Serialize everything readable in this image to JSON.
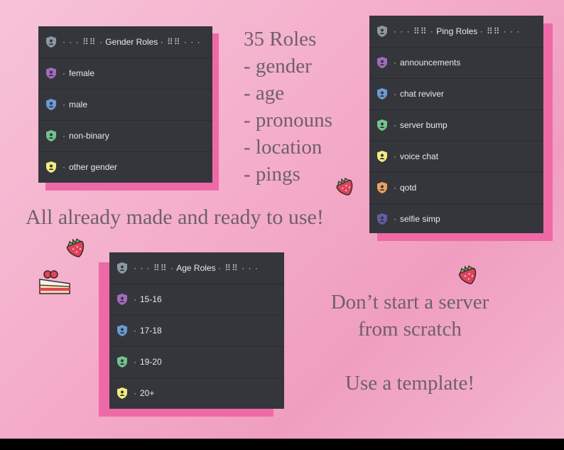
{
  "colors": {
    "panel": "#35363b",
    "accent_shadow": "#ee6aa7",
    "text": "#6f6068",
    "role_colors": {
      "grey": "#8a9aa3",
      "purple": "#a26bbd",
      "blue": "#6a9bd6",
      "green": "#72c48c",
      "yellow": "#f1ec7e",
      "orange": "#eda160",
      "indigo": "#5e5fa6"
    }
  },
  "gender_panel": {
    "title": "Gender Roles",
    "roles": [
      {
        "label": "female",
        "icon": "purple-shield-icon"
      },
      {
        "label": "male",
        "icon": "blue-shield-icon"
      },
      {
        "label": "non-binary",
        "icon": "green-shield-icon"
      },
      {
        "label": "other gender",
        "icon": "yellow-shield-icon"
      }
    ]
  },
  "ping_panel": {
    "title": "Ping Roles",
    "roles": [
      {
        "label": "announcements",
        "icon": "purple-shield-icon"
      },
      {
        "label": "chat reviver",
        "icon": "blue-shield-icon"
      },
      {
        "label": "server bump",
        "icon": "green-shield-icon"
      },
      {
        "label": "voice chat",
        "icon": "yellow-shield-icon"
      },
      {
        "label": "qotd",
        "icon": "orange-shield-icon"
      },
      {
        "label": "selfie simp",
        "icon": "indigo-shield-icon"
      }
    ]
  },
  "age_panel": {
    "title": "Age Roles",
    "roles": [
      {
        "label": "15-16",
        "icon": "purple-shield-icon"
      },
      {
        "label": "17-18",
        "icon": "blue-shield-icon"
      },
      {
        "label": "19-20",
        "icon": "green-shield-icon"
      },
      {
        "label": "20+",
        "icon": "yellow-shield-icon"
      }
    ]
  },
  "summary": {
    "count": "35 Roles",
    "items": [
      "- gender",
      "- age",
      "- pronouns",
      "- location",
      "- pings"
    ]
  },
  "headline": "All already made and ready to use!",
  "cta": {
    "line1": "Don’t start a server",
    "line2": "from scratch",
    "line3": "Use a template!"
  },
  "decorations": [
    "strawberry-icon",
    "strawberry-icon",
    "strawberry-icon",
    "cake-slice-icon"
  ]
}
